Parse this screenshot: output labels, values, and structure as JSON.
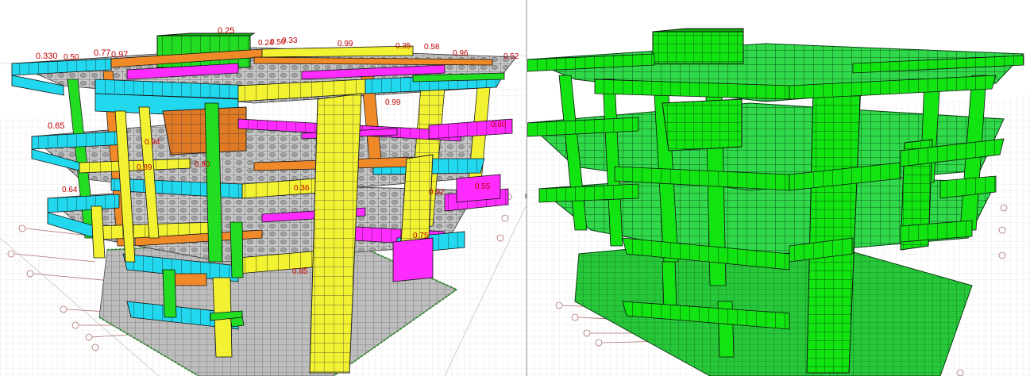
{
  "window": {
    "layout": "two-pane",
    "splitter_color": "#c8c8c8"
  },
  "left_view": {
    "name": "stress-ratio-view",
    "colors": {
      "cyan": "#22d8ee",
      "yellow": "#f2f233",
      "orange": "#f08a28",
      "magenta": "#ff2bff",
      "green": "#22dd22",
      "grey_slab": "#c7c7c7",
      "ratio_text": "#c00000"
    },
    "ratio_labels": [
      "0.25",
      "0.33",
      "0.24",
      "0.50",
      "0.99",
      "0.35",
      "0.58",
      "0.96",
      "0.52",
      "0.330",
      "0.50",
      "0.77",
      "0.97",
      "0.65",
      "0.60",
      "0.89",
      "0.94",
      "0.99",
      "0.64",
      "0.36",
      "0.55",
      "0.92",
      "0.85",
      "0.80",
      "0.75"
    ]
  },
  "right_view": {
    "name": "design-pass-view",
    "colors": {
      "member": "#12e412",
      "slab": "#2fd94a",
      "outline": "#0a0a0a"
    }
  }
}
